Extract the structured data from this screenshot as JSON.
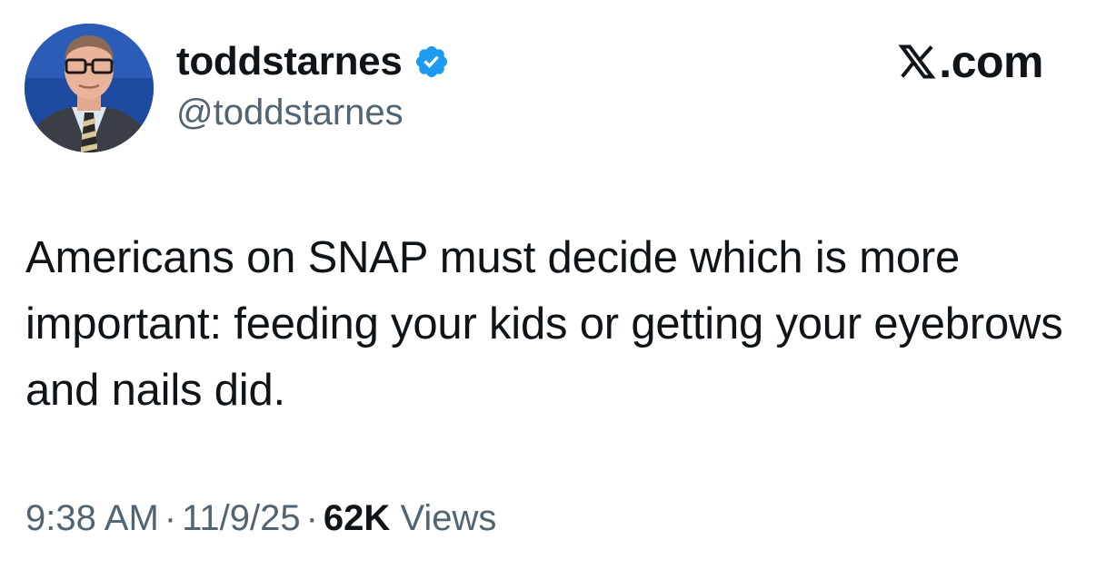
{
  "author": {
    "display_name": "toddstarnes",
    "handle": "@toddstarnes",
    "verified": true,
    "avatar_icon": "profile-photo"
  },
  "brand": {
    "logo_icon": "x-logo-icon",
    "text": ".com"
  },
  "tweet": {
    "text": "Americans on SNAP must decide which is more important: feeding your kids or getting your eyebrows and nails did."
  },
  "meta": {
    "time": "9:38 AM",
    "separator": "·",
    "date": "11/9/25",
    "views_count": "62K",
    "views_label": "Views"
  },
  "colors": {
    "text_primary": "#0f1419",
    "text_secondary": "#536471",
    "verified_blue": "#1d9bf0"
  }
}
